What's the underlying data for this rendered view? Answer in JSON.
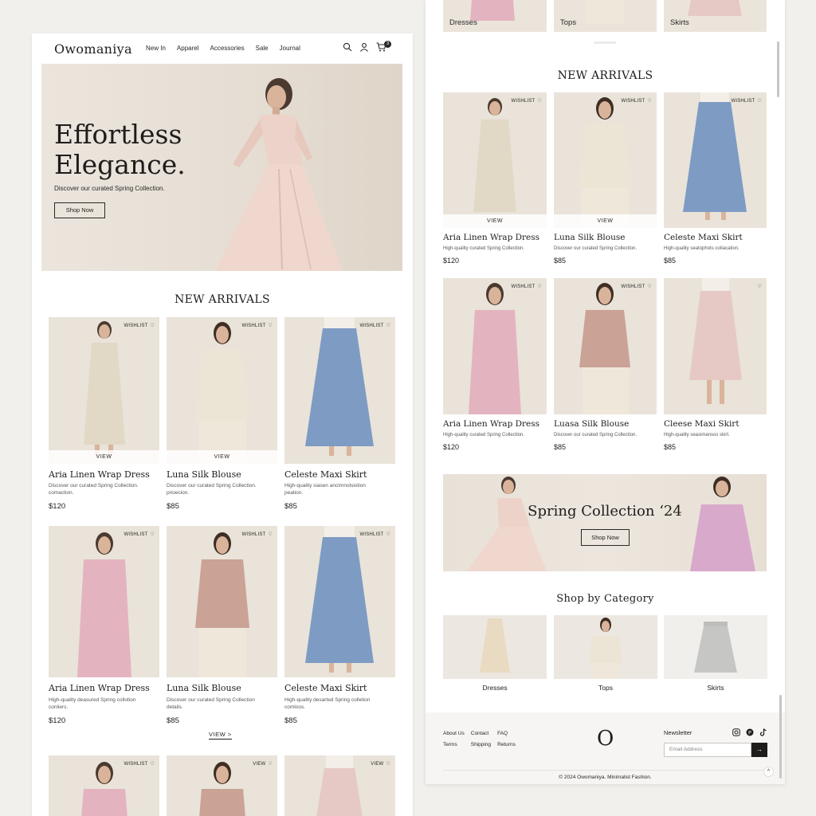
{
  "brand": {
    "name": "Owomaniya",
    "monogram": "O"
  },
  "nav": {
    "links": [
      "New In",
      "Apparel",
      "Accessories",
      "Sale",
      "Journal"
    ],
    "cart_count": "3"
  },
  "hero": {
    "title": "Effortless\nElegance.",
    "subtitle": "Discover our curated Spring Collection.",
    "button": "Shop Now"
  },
  "left": {
    "section_title": "NEW ARRIVALS",
    "row1": [
      {
        "name": "Aria Linen Wrap Dress",
        "desc": "Discover our curated Spring Collection.\ncomaction.",
        "price": "$120",
        "wishlist": "WISHLIST",
        "view": "VIEW",
        "color": "#e1d8c6"
      },
      {
        "name": "Luna Silk Blouse",
        "desc": "Discover our curated Spring Collection.\nprioecion.",
        "price": "$85",
        "wishlist": "WISHLIST",
        "view": "VIEW",
        "color": "#ece5d6"
      },
      {
        "name": "Celeste Maxi Skirt",
        "desc": "High-quality siasen ancirnnolsiotion\npeation.",
        "price": "$85",
        "wishlist": "WISHLIST",
        "color": "#7e9bc4"
      }
    ],
    "row2": [
      {
        "name": "Aria Linen Wrap Dress",
        "desc": "High-quality deasured Spring collotion\nconliers.",
        "price": "$120",
        "wishlist": "WISHLIST",
        "color": "#e4b3c0"
      },
      {
        "name": "Luna Silk Blouse",
        "desc": "Discover our curated Spring Collection\ndetails.",
        "price": "$85",
        "wishlist": "WISHLIST",
        "color": "#caa296"
      },
      {
        "name": "Celeste Maxi Skirt",
        "desc": "High-quality desarted Spring collelion\ncomloos.",
        "price": "$85",
        "wishlist": "WISHLIST",
        "color": "#7e9bc4"
      }
    ],
    "view_more": "VIEW  >",
    "row3": [
      {
        "wishlist": "WISHLIST",
        "color": "#e4b3c0"
      },
      {
        "wishlist": "VIEW",
        "color": "#caa296"
      },
      {
        "wishlist": "VIEW",
        "color": "#e6c9c4"
      }
    ]
  },
  "right": {
    "top_categories": [
      "Dresses",
      "Tops",
      "Skirts"
    ],
    "section_title": "NEW ARRIVALS",
    "row1": [
      {
        "name": "Aria Linen Wrap Dress",
        "desc": "High-quality curated Spring Collection.",
        "price": "$120",
        "wishlist": "WISHLIST",
        "view": "VIEW",
        "color": "#e1d8c6"
      },
      {
        "name": "Luna Silk Blouse",
        "desc": "Discover our curated Spring Collection.",
        "price": "$85",
        "wishlist": "WISHLIST",
        "view": "VIEW",
        "color": "#ece5d6"
      },
      {
        "name": "Celeste Maxi Skirt",
        "desc": "High-quality seatophots cotiacation.",
        "price": "$85",
        "wishlist": "WISHLIST",
        "color": "#7e9bc4"
      }
    ],
    "row2": [
      {
        "name": "Aria Linen Wrap Dress",
        "desc": "High-quality curated Spring Collection.",
        "price": "$120",
        "wishlist": "WISHLIST",
        "color": "#e4b3c0"
      },
      {
        "name": "Luasa Silk Blouse",
        "desc": "Discover our curated Spring Collection.",
        "price": "$85",
        "wishlist": "WISHLIST",
        "color": "#caa296"
      },
      {
        "name": "Cleese Maxi Skirt",
        "desc": "High-quality seasimansos skirt.",
        "price": "$85",
        "wishlist": "",
        "color": "#e6c9c4"
      }
    ],
    "banner": {
      "title": "Spring Collection ‘24",
      "button": "Shop Now"
    },
    "category_title": "Shop by Category",
    "categories": [
      {
        "label": "Dresses",
        "color": "#e9dac2"
      },
      {
        "label": "Tops",
        "color": "#ece5d6"
      },
      {
        "label": "Skirts",
        "color": "#c6c7c5"
      }
    ]
  },
  "footer": {
    "links": [
      "About Us",
      "Contact",
      "FAQ",
      "Terms",
      "Shipping",
      "Returns"
    ],
    "newsletter_label": "Newsletter",
    "email_placeholder": "Email Address",
    "submit": "→",
    "copyright": "© 2024 Owomaniya. Minimalist Fashion.",
    "to_top": "^",
    "social": [
      "instagram-icon",
      "pinterest-icon",
      "tiktok-icon"
    ]
  }
}
